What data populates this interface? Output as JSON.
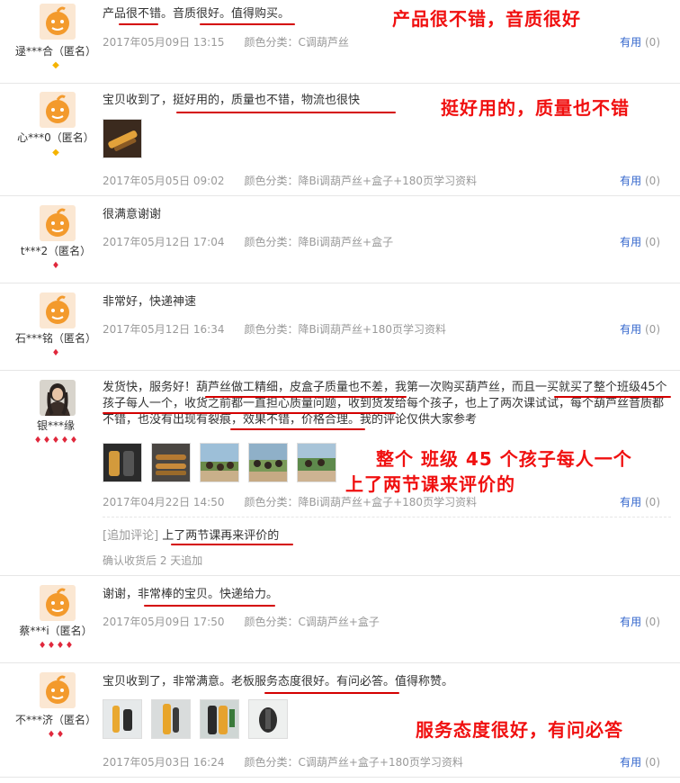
{
  "reviews": [
    {
      "user": "逯***合（匿名）",
      "badge": "yellow",
      "badge_count": 1,
      "content": "产品很不错。音质很好。值得购买。",
      "date": "2017年05月09日 13:15",
      "color": "颜色分类：C调葫芦丝",
      "useful_label": "有用",
      "useful_count": "(0)",
      "annotation": "产品很不错，音质很好"
    },
    {
      "user": "心***0（匿名）",
      "badge": "yellow",
      "badge_count": 1,
      "content": "宝贝收到了，挺好用的，质量也不错，物流也很快",
      "date": "2017年05月05日 09:02",
      "color": "颜色分类：降Bi调葫芦丝+盒子+180页学习资料",
      "useful_label": "有用",
      "useful_count": "(0)",
      "annotation": "挺好用的，质量也不错"
    },
    {
      "user": "t***2（匿名）",
      "badge": "red",
      "badge_count": 1,
      "content": "很满意谢谢",
      "date": "2017年05月12日 17:04",
      "color": "颜色分类：降Bi调葫芦丝+盒子",
      "useful_label": "有用",
      "useful_count": "(0)"
    },
    {
      "user": "石***铭（匿名）",
      "badge": "red",
      "badge_count": 1,
      "content": "非常好，快递神速",
      "date": "2017年05月12日 16:34",
      "color": "颜色分类：降Bi调葫芦丝+180页学习资料",
      "useful_label": "有用",
      "useful_count": "(0)"
    },
    {
      "user": "银***缘",
      "badge": "red",
      "badge_count": 5,
      "content": "发货快，服务好！葫芦丝做工精细，皮盒子质量也不差，我第一次购买葫芦丝，而且一买就买了整个班级45个孩子每人一个，收货之前都一直担心质量问题，收到货发给每个孩子，也上了两次课试试，每个葫芦丝音质都不错，也没有出现有裂痕，效果不错，价格合理。我的评论仅供大家参考",
      "date": "2017年04月22日 14:50",
      "color": "颜色分类：降Bi调葫芦丝+盒子+180页学习资料",
      "useful_label": "有用",
      "useful_count": "(0)",
      "annotation_line1": "整个 班级 45 个孩子每人一个",
      "annotation_line2": "上了两节课来评价的",
      "append_tag": "[追加评论]",
      "append_text": "上了两节课再来评价的",
      "append_sub": "确认收货后 2 天追加"
    },
    {
      "user": "蔡***i（匿名）",
      "badge": "red",
      "badge_count": 4,
      "content": "谢谢，非常棒的宝贝。快递给力。",
      "date": "2017年05月09日 17:50",
      "color": "颜色分类：C调葫芦丝+盒子",
      "useful_label": "有用",
      "useful_count": "(0)"
    },
    {
      "user": "不***济（匿名）",
      "badge": "red",
      "badge_count": 2,
      "content": "宝贝收到了，非常满意。老板服务态度很好。有问必答。值得称赞。",
      "date": "2017年05月03日 16:24",
      "color": "颜色分类：C调葫芦丝+盒子+180页学习资料",
      "useful_label": "有用",
      "useful_count": "(0)",
      "annotation": "服务态度很好，有问必答"
    }
  ]
}
